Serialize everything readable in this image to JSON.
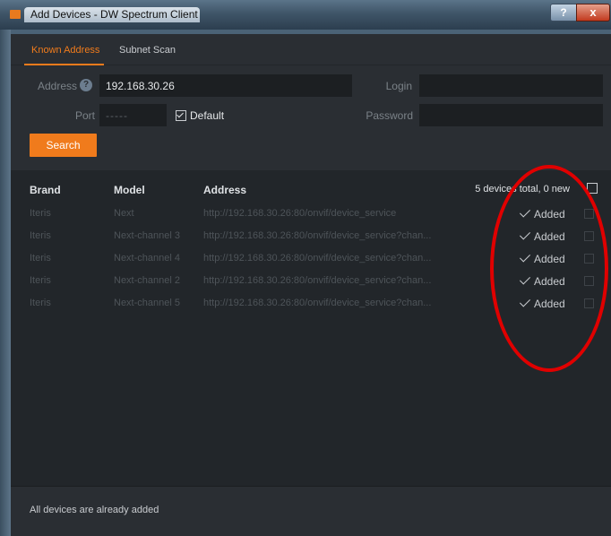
{
  "window": {
    "title": "Add Devices - DW Spectrum Client",
    "help_glyph": "?",
    "close_glyph": "x"
  },
  "tabs": [
    {
      "label": "Known Address",
      "active": true
    },
    {
      "label": "Subnet Scan",
      "active": false
    }
  ],
  "form": {
    "address_label": "Address",
    "address_value": "192.168.30.26",
    "login_label": "Login",
    "login_value": "",
    "port_label": "Port",
    "port_placeholder": "-----",
    "default_label": "Default",
    "default_checked": true,
    "password_label": "Password",
    "password_value": "",
    "search_label": "Search"
  },
  "results": {
    "columns": [
      "Brand",
      "Model",
      "Address"
    ],
    "summary": "5 devices total, 0 new",
    "rows": [
      {
        "brand": "Iteris",
        "model": "Next",
        "address": "http://192.168.30.26:80/onvif/device_service",
        "status": "Added"
      },
      {
        "brand": "Iteris",
        "model": "Next-channel 3",
        "address": "http://192.168.30.26:80/onvif/device_service?chan...",
        "status": "Added"
      },
      {
        "brand": "Iteris",
        "model": "Next-channel 4",
        "address": "http://192.168.30.26:80/onvif/device_service?chan...",
        "status": "Added"
      },
      {
        "brand": "Iteris",
        "model": "Next-channel 2",
        "address": "http://192.168.30.26:80/onvif/device_service?chan...",
        "status": "Added"
      },
      {
        "brand": "Iteris",
        "model": "Next-channel 5",
        "address": "http://192.168.30.26:80/onvif/device_service?chan...",
        "status": "Added"
      }
    ]
  },
  "status_text": "All devices are already added",
  "colors": {
    "accent": "#f07b1c",
    "annotation": "#e00000",
    "background": "#2a2e33"
  }
}
